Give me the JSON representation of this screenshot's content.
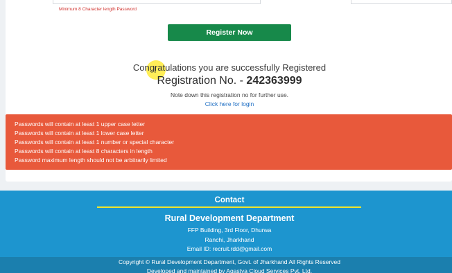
{
  "form": {
    "password_hint": "Minimum 8 Character length Password",
    "register_label": "Register Now"
  },
  "success": {
    "congrats": "Congratulations you are successfully Registered",
    "reg_label": "Registration No. - ",
    "reg_number": "242363999",
    "note": "Note down this registration no for further use.",
    "login_link": "Click here for login"
  },
  "password_rules": [
    "Passwords will contain at least 1 upper case letter",
    "Passwords will contain at least 1 lower case letter",
    "Passwords will contain at least 1 number or special character",
    "Passwords will contain at least 8 characters in length",
    "Password maximum length should not be arbitrarily limited"
  ],
  "footer": {
    "contact_title": "Contact",
    "department": "Rural Development Department",
    "address_line1": "FFP Building, 3rd Floor, Dhurwa",
    "address_line2": "Ranchi, Jharkhand",
    "email": "Email ID: recruit.rdd@gmail.com",
    "copyright": "Copyright © Rural Development Department, Govt. of Jharkhand All Rights Reserved",
    "developer": "Developed and maintained by Agastya Cloud Services Pvt. Ltd."
  },
  "colors": {
    "register_button": "#17894a",
    "rules_box": "#e8593b",
    "footer": "#1d95cf",
    "footer_accent_line": "#f1e52b",
    "link": "#1f6fc4"
  },
  "icons": [
    "text-cursor-icon"
  ]
}
